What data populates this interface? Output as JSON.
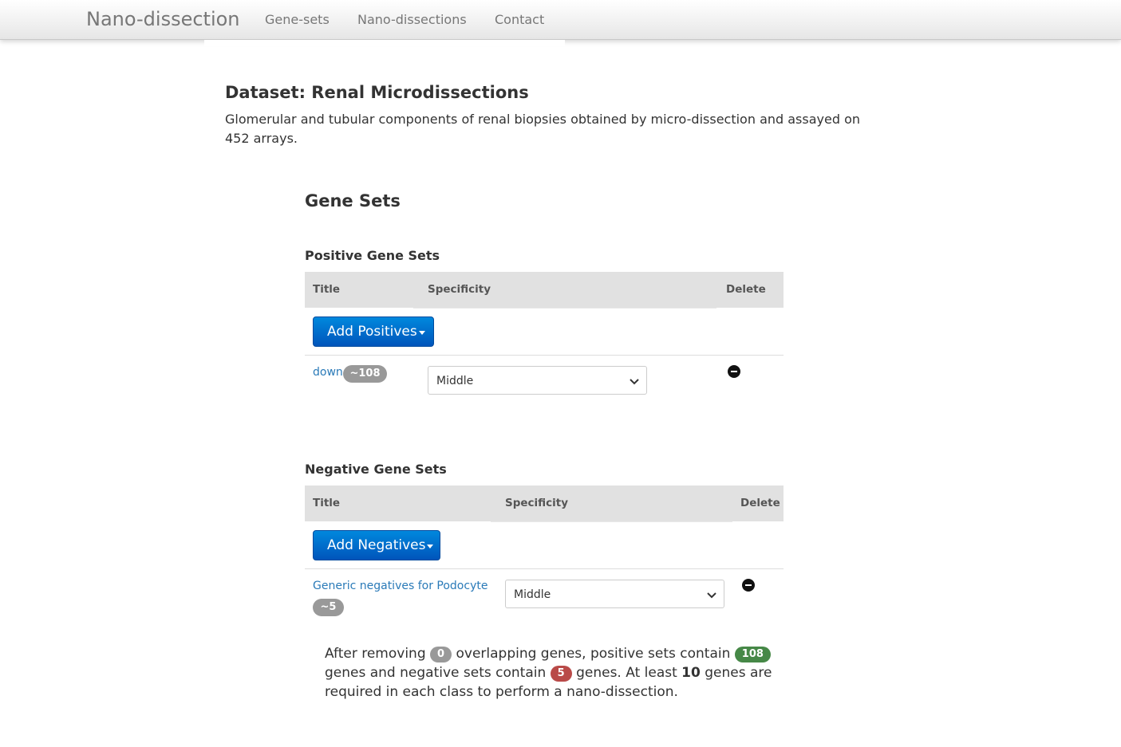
{
  "navbar": {
    "brand": "Nano-dissection",
    "links": [
      "Gene-sets",
      "Nano-dissections",
      "Contact"
    ]
  },
  "dataset": {
    "title": "Dataset: Renal Microdissections",
    "description": "Glomerular and tubular components of renal biopsies obtained by micro-dissection and assayed on 452 arrays."
  },
  "gene_sets": {
    "heading": "Gene Sets",
    "positive": {
      "heading": "Positive Gene Sets",
      "columns": [
        "Title",
        "Specificity",
        "Delete"
      ],
      "add_button": "Add Positives",
      "rows": [
        {
          "title": "down",
          "count": "~108",
          "specificity": "Middle"
        }
      ]
    },
    "negative": {
      "heading": "Negative Gene Sets",
      "columns": [
        "Title",
        "Specificity",
        "Delete"
      ],
      "add_button": "Add Negatives",
      "rows": [
        {
          "title": "Generic negatives for Podocyte",
          "count": "~5",
          "specificity": "Middle"
        }
      ]
    }
  },
  "summary": {
    "t1": "After removing",
    "overlap": "0",
    "t2": "overlapping genes, positive sets contain",
    "positive": "108",
    "t3": "genes and negative sets contain",
    "negative": "5",
    "t4": "genes. At least",
    "required": "10",
    "t5": "genes are required in each class to perform a nano-dissection."
  },
  "colors": {
    "primary": "#0066cc",
    "link": "#2a7ab8",
    "badge_grey": "#999999",
    "badge_green": "#468847",
    "badge_red": "#b94a48"
  }
}
